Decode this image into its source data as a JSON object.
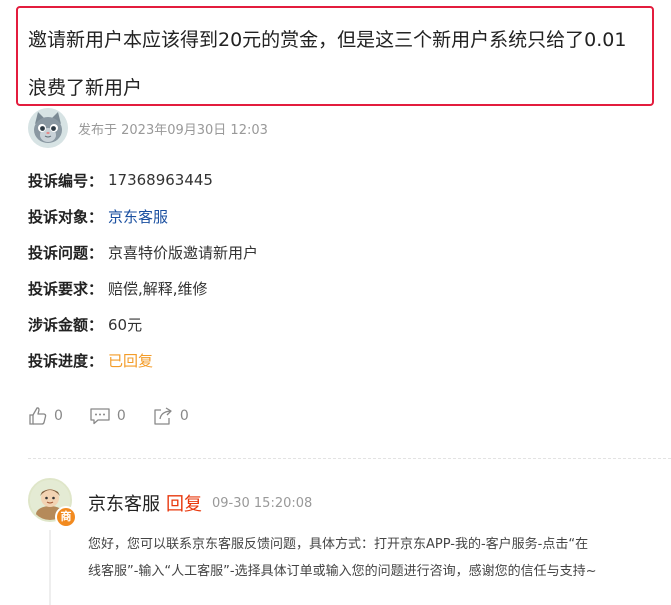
{
  "complaint": {
    "title_line1": "邀请新用户本应该得到20元的赏金，但是这三个新用户系统只给了0.01",
    "title_line2": "浪费了新用户",
    "post_time": "发布于 2023年09月30日 12:03",
    "fields": [
      {
        "label": "投诉编号：",
        "value": "17368963445"
      },
      {
        "label": "投诉对象：",
        "value": "京东客服"
      },
      {
        "label": "投诉问题：",
        "value": "京喜特价版邀请新用户"
      },
      {
        "label": "投诉要求：",
        "value": "赔偿,解释,维修"
      },
      {
        "label": "涉诉金额：",
        "value": "60元"
      },
      {
        "label": "投诉进度：",
        "value": "已回复"
      }
    ]
  },
  "actions": {
    "like_icon": "thumbs-up-icon",
    "like_count": "0",
    "comment_icon": "comment-icon",
    "comment_count": "0",
    "share_icon": "share-icon",
    "share_count": "0"
  },
  "reply": {
    "name": "京东客服",
    "tag": "回复",
    "time": "09-30 15:20:08",
    "badge": "商",
    "body_line1": "您好，您可以联系京东客服反馈问题，具体方式：打开京东APP-我的-客户服务-点击“在",
    "body_line2": "线客服”-输入“人工客服”-选择具体订单或输入您的问题进行咨询，感谢您的信任与支持~"
  },
  "colors": {
    "highlight_border": "#e31c3d",
    "link_blue": "#1a4fa0",
    "status_orange": "#f39c29",
    "reply_tag_red": "#e8380d",
    "badge_orange": "#f28a1f"
  }
}
